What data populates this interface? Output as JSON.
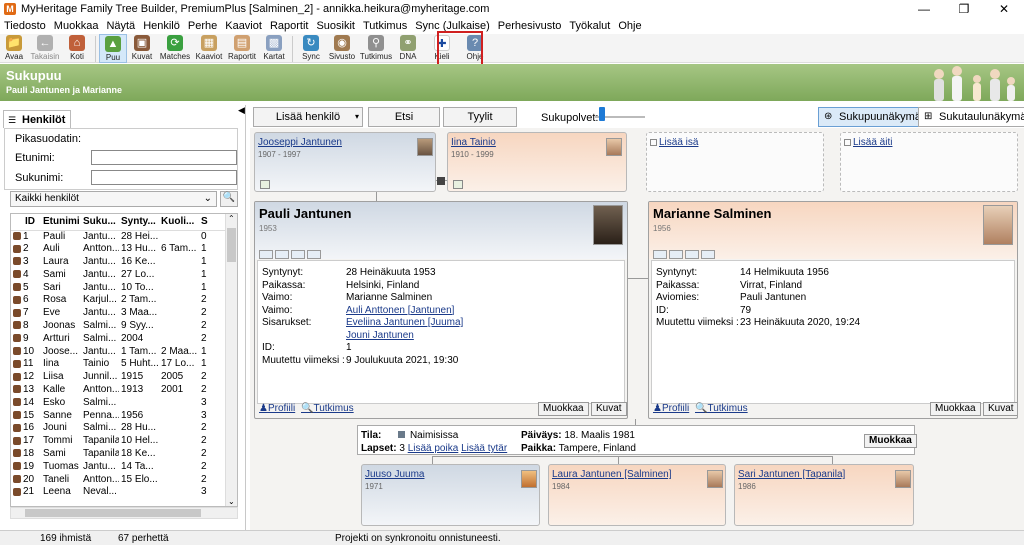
{
  "window": {
    "title": "MyHeritage Family Tree Builder, PremiumPlus [Salminen_2] - annikka.heikura@myheritage.com",
    "app_icon": "M"
  },
  "menu": [
    "Tiedosto",
    "Muokkaa",
    "Näytä",
    "Henkilö",
    "Perhe",
    "Kaaviot",
    "Raportit",
    "Suosikit",
    "Tutkimus",
    "Sync (Julkaise)",
    "Perhesivusto",
    "Työkalut",
    "Ohje"
  ],
  "toolbar": [
    {
      "label": "Avaa",
      "icon": "folder-icon",
      "color": "#c89a3a"
    },
    {
      "label": "Takaisin",
      "icon": "back-arrow-icon",
      "color": "#b0b0b0"
    },
    {
      "label": "Koti",
      "icon": "home-icon",
      "color": "#c0603a"
    },
    {
      "label": "Puu",
      "icon": "tree-icon",
      "color": "#5aa040"
    },
    {
      "label": "Kuvat",
      "icon": "photos-icon",
      "color": "#8a5a3a"
    },
    {
      "label": "Matches",
      "icon": "matches-icon",
      "color": "#3aa040"
    },
    {
      "label": "Kaaviot",
      "icon": "charts-icon",
      "color": "#c8a060"
    },
    {
      "label": "Raportit",
      "icon": "reports-icon",
      "color": "#d0a070"
    },
    {
      "label": "Kartat",
      "icon": "maps-icon",
      "color": "#8aa0c0"
    },
    {
      "label": "Sync",
      "icon": "sync-icon",
      "color": "#3a8ac0"
    },
    {
      "label": "Sivusto",
      "icon": "website-icon",
      "color": "#a07a50"
    },
    {
      "label": "Tutkimus",
      "icon": "research-icon",
      "color": "#909090"
    },
    {
      "label": "DNA",
      "icon": "dna-icon",
      "color": "#90a070"
    },
    {
      "label": "Kieli",
      "icon": "finnish-flag-icon",
      "color": "#2a5ab0"
    },
    {
      "label": "Ohje",
      "icon": "help-icon",
      "color": "#6a8ab0"
    }
  ],
  "banner": {
    "title": "Sukupuu",
    "subtitle": "Pauli Jantunen ja Marianne"
  },
  "left": {
    "tab": "Henkilöt",
    "filter_title": "Pikasuodatin:",
    "first_name_label": "Etunimi:",
    "last_name_label": "Sukunimi:",
    "select_value": "Kaikki henkilöt",
    "columns": [
      "ID",
      "Etunimi",
      "Suku...",
      "Synty...",
      "Kuoli...",
      "S"
    ],
    "rows": [
      [
        "1",
        "Pauli",
        "Jantu...",
        "28 Hei...",
        "",
        "0"
      ],
      [
        "2",
        "Auli",
        "Antton...",
        "13 Hu...",
        "6 Tam...",
        "1"
      ],
      [
        "3",
        "Laura",
        "Jantu...",
        "16 Ke...",
        "",
        "1"
      ],
      [
        "4",
        "Sami",
        "Jantu...",
        "27 Lo...",
        "",
        "1"
      ],
      [
        "5",
        "Sari",
        "Jantu...",
        "10 To...",
        "",
        "1"
      ],
      [
        "6",
        "Rosa",
        "Karjul...",
        "2 Tam...",
        "",
        "2"
      ],
      [
        "7",
        "Eve",
        "Jantu...",
        "3 Maa...",
        "",
        "2"
      ],
      [
        "8",
        "Joonas",
        "Salmi...",
        "9 Syy...",
        "",
        "2"
      ],
      [
        "9",
        "Artturi",
        "Salmi...",
        "2004",
        "",
        "2"
      ],
      [
        "10",
        "Joose...",
        "Jantu...",
        "1 Tam...",
        "2 Maa...",
        "1"
      ],
      [
        "11",
        "Iina",
        "Tainio",
        "5 Huht...",
        "17 Lo...",
        "1"
      ],
      [
        "12",
        "Liisa",
        "Junnil...",
        "1915",
        "2005",
        "2"
      ],
      [
        "13",
        "Kalle",
        "Antton...",
        "1913",
        "2001",
        "2"
      ],
      [
        "14",
        "Esko",
        "Salmi...",
        "",
        "",
        "3"
      ],
      [
        "15",
        "Sanne",
        "Penna...",
        "1956",
        "",
        "3"
      ],
      [
        "16",
        "Jouni",
        "Salmi...",
        "28 Hu...",
        "",
        "2"
      ],
      [
        "17",
        "Tommi",
        "Tapanila",
        "10 Hel...",
        "",
        "2"
      ],
      [
        "18",
        "Sami",
        "Tapanila",
        "18 Ke...",
        "",
        "2"
      ],
      [
        "19",
        "Tuomas",
        "Jantu...",
        "14 Ta...",
        "",
        "2"
      ],
      [
        "20",
        "Taneli",
        "Antton...",
        "15 Elo...",
        "",
        "2"
      ],
      [
        "21",
        "Leena",
        "Neval...",
        "",
        "",
        "3"
      ]
    ]
  },
  "controls": {
    "add_person": "Lisää henkilö",
    "search": "Etsi",
    "styles": "Tyylit",
    "generations": "Sukupolvet:",
    "tree_view": "Sukupuunäkymä",
    "table_view": "Sukutaulunäkymä",
    "generations_level": 0.1
  },
  "parents": {
    "father": {
      "name": "Jooseppi Jantunen",
      "years": "1907 - 1997"
    },
    "mother": {
      "name": "Iina Tainio",
      "years": "1910 - 1999"
    },
    "add_father": "Lisää isä",
    "add_mother": "Lisää äiti"
  },
  "pauli": {
    "name": "Pauli Jantunen",
    "year": "1953",
    "rows": [
      [
        "Syntynyt:",
        "28 Heinäkuuta 1953"
      ],
      [
        "Paikassa:",
        "Helsinki, Finland"
      ],
      [
        "Vaimo:",
        "Marianne Salminen"
      ],
      [
        "Vaimo:",
        "Auli Anttonen [Jantunen]"
      ],
      [
        "Sisarukset:",
        "Eveliina Jantunen [Juuma]"
      ],
      [
        "",
        "Jouni Jantunen"
      ],
      [
        "ID:",
        "1"
      ],
      [
        "Muutettu viimeksi :",
        "9 Joulukuuta 2021, 19:30"
      ]
    ],
    "profile": "Profiili",
    "research": "Tutkimus",
    "edit": "Muokkaa",
    "photos": "Kuvat"
  },
  "marianne": {
    "name": "Marianne Salminen",
    "year": "1956",
    "rows": [
      [
        "Syntynyt:",
        "14 Helmikuuta 1956"
      ],
      [
        "Paikassa:",
        "Virrat, Finland"
      ],
      [
        "Aviomies:",
        "Pauli Jantunen"
      ],
      [
        "ID:",
        "79"
      ],
      [
        "Muutettu viimeksi :",
        "23 Heinäkuuta 2020, 19:24"
      ]
    ],
    "profile": "Profiili",
    "research": "Tutkimus",
    "edit": "Muokkaa",
    "photos": "Kuvat"
  },
  "union": {
    "status_label": "Tila:",
    "status": "Naimisissa",
    "children_label": "Lapset:",
    "children_count": "3",
    "add_son": "Lisää poika",
    "add_daughter": "Lisää tytär",
    "date_label": "Päiväys:",
    "date": "18. Maalis 1981",
    "place_label": "Paikka:",
    "place": "Tampere, Finland",
    "edit": "Muokkaa"
  },
  "children": [
    {
      "name": "Juuso Juuma",
      "year": "1971"
    },
    {
      "name": "Laura Jantunen [Salminen]",
      "year": "1984"
    },
    {
      "name": "Sari Jantunen [Tapanila]",
      "year": "1986"
    }
  ],
  "status": {
    "people": "169 ihmistä",
    "families": "67 perhettä",
    "message": "Projekti on synkronoitu onnistuneesti."
  }
}
